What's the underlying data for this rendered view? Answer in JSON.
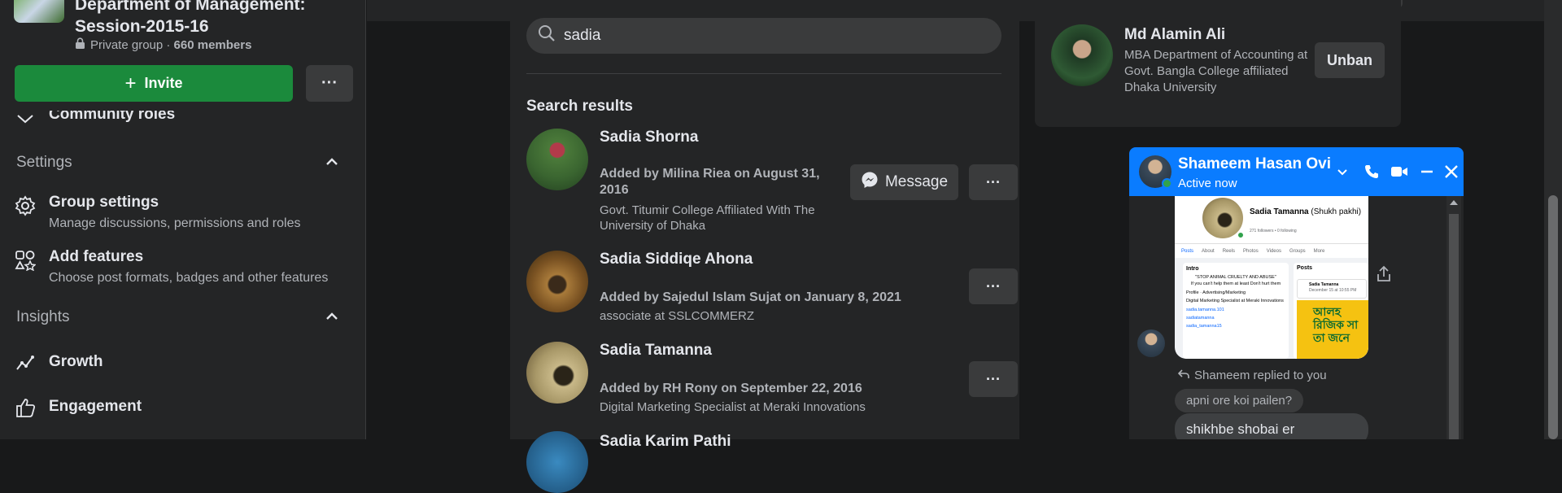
{
  "group": {
    "name_line1": "Department of Management:",
    "name_line2": "Session-2015-16",
    "privacy": "Private group · ",
    "members": "660 members",
    "invite_label": "Invite",
    "more_label": "···"
  },
  "sidebar": {
    "community_roles_label": "Community roles",
    "settings_section": "Settings",
    "group_settings_title": "Group settings",
    "group_settings_sub": "Manage discussions, permissions and roles",
    "add_features_title": "Add features",
    "add_features_sub": "Choose post formats, badges and other features",
    "insights_section": "Insights",
    "growth_label": "Growth",
    "engagement_label": "Engagement"
  },
  "search": {
    "value": "sadia",
    "results_label": "Search results"
  },
  "results": [
    {
      "name": "Sadia Shorna",
      "added_line1": "Added by Milina Riea on August 31,",
      "added_line2": "2016",
      "work_line1": "Govt. Titumir College Affiliated With The",
      "work_line2": "University of Dhaka",
      "message_label": "Message",
      "more_label": "···"
    },
    {
      "name": "Sadia Siddiqe Ahona",
      "added_line1": "Added by Sajedul Islam Sujat on January 8, 2021",
      "work_line1": "associate at SSLCOMMERZ",
      "more_label": "···"
    },
    {
      "name": "Sadia Tamanna",
      "added_line1": "Added by RH Rony on September 22, 2016",
      "work_line1": "Digital Marketing Specialist at Meraki Innovations",
      "more_label": "···"
    },
    {
      "name": "Sadia Karim Pathi"
    }
  ],
  "banned": {
    "name": "Md Alamin Ali",
    "desc": "MBA Department of Accounting at Govt. Bangla College affiliated Dhaka University",
    "unban_label": "Unban"
  },
  "chat": {
    "contact_name": "Shameem Hasan Ovi",
    "status": "Active now",
    "replied_text": "Shameem replied to you",
    "message1": "apni ore koi pailen?",
    "message2": "shikhbe shobai er",
    "preview": {
      "profile_name": "Sadia Tamanna",
      "profile_suffix": "(Shukh pakhi)",
      "followers": "271 followers • 0 following",
      "tabs": [
        "Posts",
        "About",
        "Reels",
        "Photos",
        "Videos",
        "Groups",
        "More"
      ],
      "intro_label": "Intro",
      "posts_label": "Posts",
      "intro_quote": "\"STOP ANIMAL CRUELTY AND ABUSE\"",
      "intro_quote2": "If you can't help them at least Don't hurt them",
      "profile_line": "Profile · Advertising/Marketing",
      "job_line": "Digital Marketing Specialist at Meraki Innovations",
      "link1": "sadia.tamanna.101",
      "link2": "sadiatamanna",
      "link3": "sadia_tamanna15",
      "post_name": "Sadia Tamanna",
      "post_date": "December 15 at 10:55 PM",
      "bangla_line1": "আলহ",
      "bangla_line2": "রিজিক সা",
      "bangla_line3": "তা জনে"
    }
  },
  "colors": {
    "accent_green": "#1b8a3c",
    "messenger_blue": "#0a7cff",
    "panel": "#242526",
    "background": "#18191a"
  }
}
